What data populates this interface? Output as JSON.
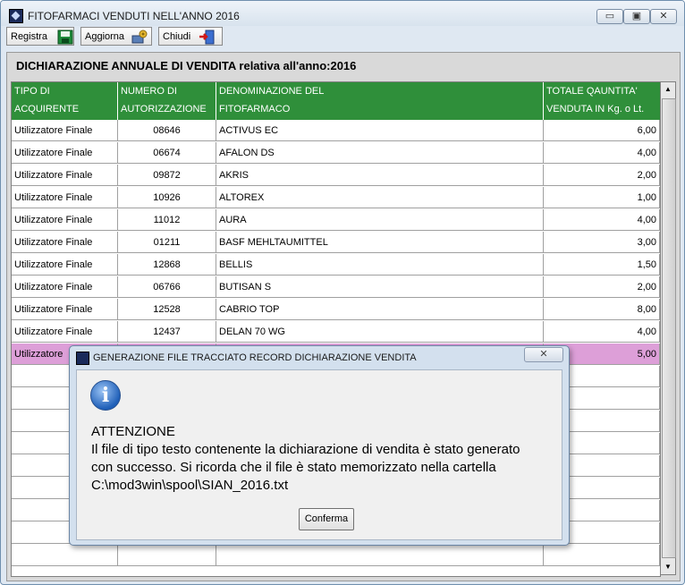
{
  "window": {
    "title": "FITOFARMACI VENDUTI NELL'ANNO 2016",
    "controls": {
      "minimize": "▭",
      "maximize": "▣",
      "close": "✕"
    }
  },
  "toolbar": {
    "register_label": "Registra",
    "update_label": "Aggiorna",
    "close_label": "Chiudi"
  },
  "heading": "DICHIARAZIONE ANNUALE DI VENDITA relativa all'anno:2016",
  "table": {
    "headers": [
      [
        "TIPO DI",
        "ACQUIRENTE"
      ],
      [
        "NUMERO DI",
        "AUTORIZZAZIONE"
      ],
      [
        "DENOMINAZIONE DEL",
        "FITOFARMACO"
      ],
      [
        "TOTALE QAUNTITA'",
        "VENDUTA IN Kg. o Lt."
      ]
    ],
    "rows": [
      {
        "buyer": "Utilizzatore Finale",
        "auth": "08646",
        "name": "ACTIVUS EC",
        "qty": "6,00"
      },
      {
        "buyer": "Utilizzatore Finale",
        "auth": "06674",
        "name": "AFALON DS",
        "qty": "4,00"
      },
      {
        "buyer": "Utilizzatore Finale",
        "auth": "09872",
        "name": "AKRIS",
        "qty": "2,00"
      },
      {
        "buyer": "Utilizzatore Finale",
        "auth": "10926",
        "name": "ALTOREX",
        "qty": "1,00"
      },
      {
        "buyer": "Utilizzatore Finale",
        "auth": "11012",
        "name": "AURA",
        "qty": "4,00"
      },
      {
        "buyer": "Utilizzatore Finale",
        "auth": "01211",
        "name": "BASF MEHLTAUMITTEL",
        "qty": "3,00"
      },
      {
        "buyer": "Utilizzatore Finale",
        "auth": "12868",
        "name": "BELLIS",
        "qty": "1,50"
      },
      {
        "buyer": "Utilizzatore Finale",
        "auth": "06766",
        "name": "BUTISAN S",
        "qty": "2,00"
      },
      {
        "buyer": "Utilizzatore Finale",
        "auth": "12528",
        "name": "CABRIO TOP",
        "qty": "8,00"
      },
      {
        "buyer": "Utilizzatore Finale",
        "auth": "12437",
        "name": "DELAN 70 WG",
        "qty": "4,00"
      },
      {
        "buyer": "Utilizzatore",
        "auth": "",
        "name": "",
        "qty": "5,00"
      }
    ],
    "selected_row_index": 10,
    "empty_rows": 9,
    "header_color": "#2f8f3a",
    "selected_color": "#dd9fd8"
  },
  "dialog": {
    "title": "GENERAZIONE FILE TRACCIATO RECORD DICHIARAZIONE VENDITA",
    "close_label": "✕",
    "icon": "info-icon",
    "message_title": "ATTENZIONE",
    "message_lines": [
      "Il file di tipo testo contenente la dichiarazione di vendita è stato generato",
      "con successo. Si ricorda che il file è stato memorizzato nella cartella",
      "C:\\mod3win\\spool\\SIAN_2016.txt"
    ],
    "confirm_label": "Conferma"
  }
}
